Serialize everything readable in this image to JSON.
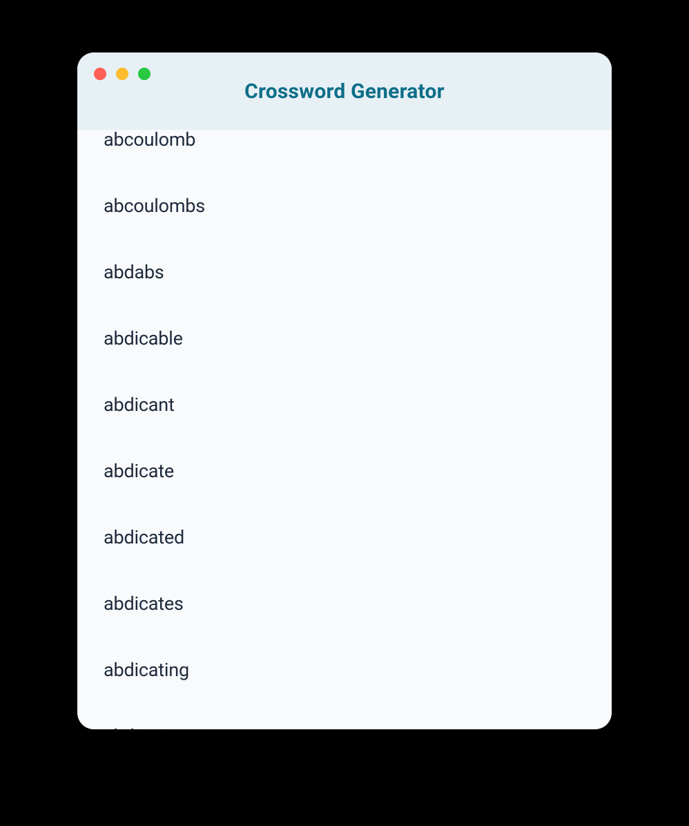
{
  "window": {
    "title": "Crossword Generator"
  },
  "words": [
    "abcoulomb",
    "abcoulombs",
    "abdabs",
    "abdicable",
    "abdicant",
    "abdicate",
    "abdicated",
    "abdicates",
    "abdicating",
    "abdication"
  ]
}
